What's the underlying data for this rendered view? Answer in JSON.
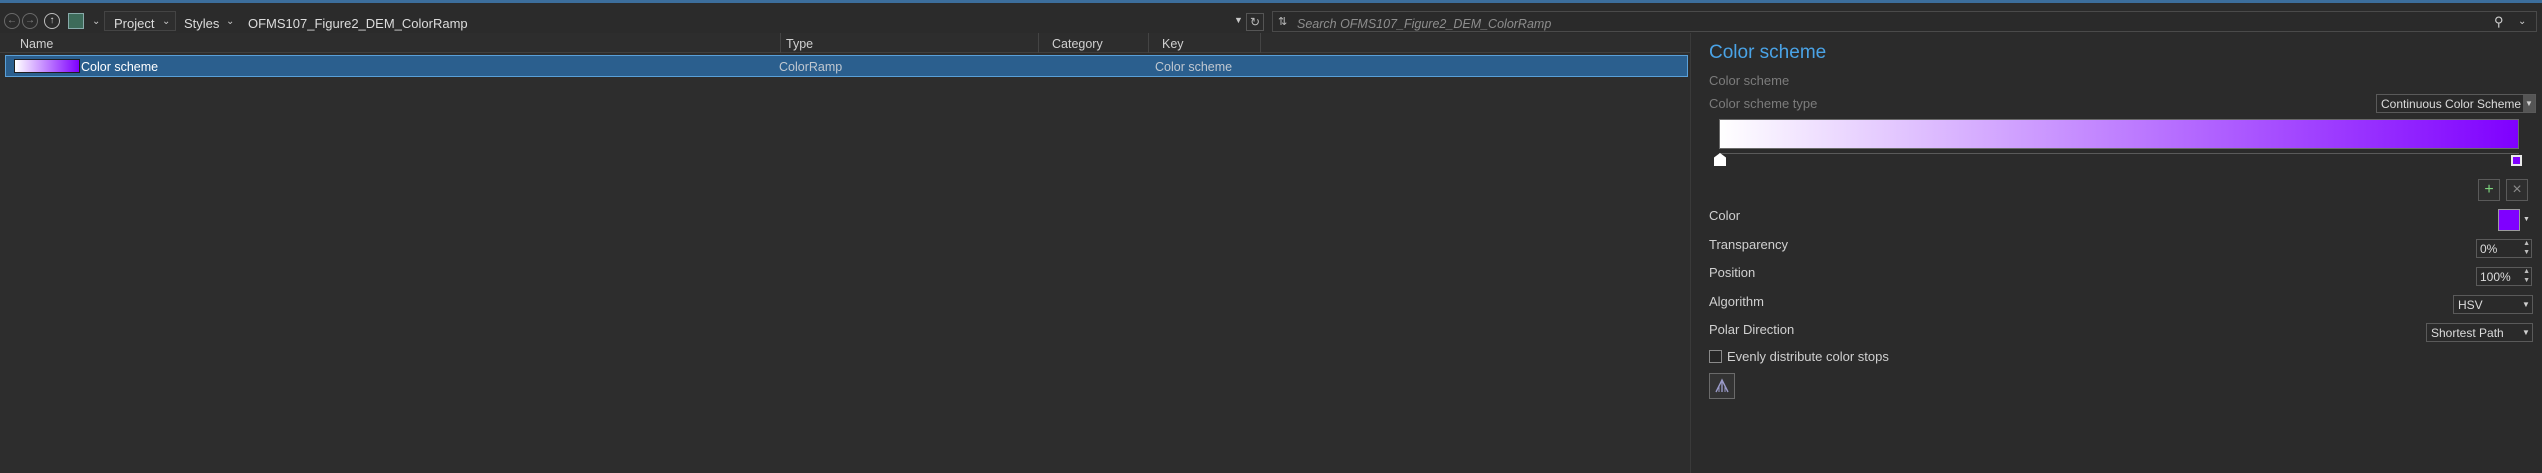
{
  "toolbar": {
    "breadcrumbs": [
      "Project",
      "Styles",
      "OFMS107_Figure2_DEM_ColorRamp"
    ],
    "search_placeholder": "Search OFMS107_Figure2_DEM_ColorRamp",
    "icons": [
      "back-arrow-icon",
      "forward-arrow-icon",
      "up-arrow-icon",
      "style-catalog-icon",
      "refresh-icon",
      "sort-icon",
      "search-icon"
    ]
  },
  "list": {
    "columns": [
      "Name",
      "Type",
      "Category",
      "Key"
    ],
    "rows": [
      {
        "name": "Color scheme",
        "type": "ColorRamp",
        "category": "",
        "key": "Color scheme",
        "ramp_start": "#ffffff",
        "ramp_end": "#7f00ff"
      }
    ]
  },
  "pane": {
    "title": "Color scheme",
    "subtitle": "Color scheme",
    "scheme_type_label": "Color scheme type",
    "scheme_type_value": "Continuous Color Scheme",
    "ramp_colors": {
      "start": "#ffffff",
      "end": "#7f00ff"
    },
    "add_label": "+",
    "remove_label": "×",
    "color_label": "Color",
    "color_value": "#7f00ff",
    "transparency_label": "Transparency",
    "transparency_value": "0%",
    "position_label": "Position",
    "position_value": "100%",
    "algorithm_label": "Algorithm",
    "algorithm_value": "HSV",
    "polar_label": "Polar Direction",
    "polar_value": "Shortest Path",
    "evenly_label": "Evenly distribute color stops",
    "evenly_checked": false
  },
  "colors": {
    "accent": "#4aa3e6",
    "selection": "#2b5f8e",
    "background": "#2b2b2b"
  }
}
